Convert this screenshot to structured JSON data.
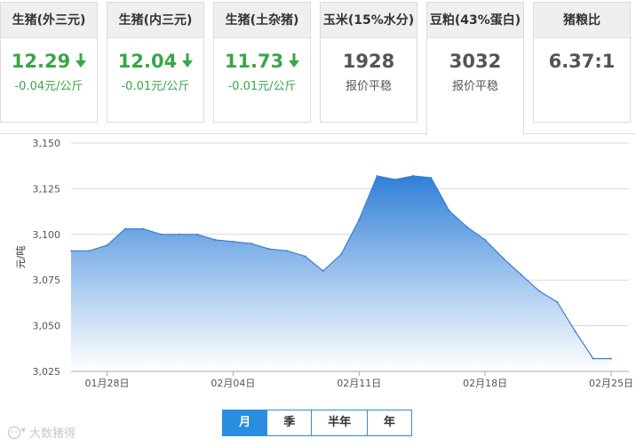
{
  "cards": [
    {
      "title": "生猪(外三元)",
      "value": "12.29",
      "change": "-0.04元/公斤",
      "trend": "down"
    },
    {
      "title": "生猪(内三元)",
      "value": "12.04",
      "change": "-0.01元/公斤",
      "trend": "down"
    },
    {
      "title": "生猪(土杂猪)",
      "value": "11.73",
      "change": "-0.01元/公斤",
      "trend": "down"
    },
    {
      "title": "玉米(15%水分)",
      "value": "1928",
      "change": "报价平稳",
      "trend": "flat"
    },
    {
      "title": "豆粕(43%蛋白)",
      "value": "3032",
      "change": "报价平稳",
      "trend": "flat"
    },
    {
      "title": "猪粮比",
      "value": "6.37:1",
      "change": "",
      "trend": "flat"
    }
  ],
  "colors": {
    "down": "#3aa64a",
    "accent": "#2b8de0",
    "area_top": "#2f7fd8",
    "area_bottom": "#ffffff"
  },
  "chart_data": {
    "type": "area",
    "ylabel": "元/吨",
    "ylim": [
      3025,
      3150
    ],
    "yticks": [
      "3,025",
      "3,050",
      "3,075",
      "3,100",
      "3,125",
      "3,150"
    ],
    "ytick_values": [
      3025,
      3050,
      3075,
      3100,
      3125,
      3150
    ],
    "xtick_labels": [
      "01月28日",
      "02月04日",
      "02月11日",
      "02月18日",
      "02月25日"
    ],
    "xtick_index": [
      2,
      9,
      16,
      23,
      30
    ],
    "grid": true,
    "series": [
      {
        "values": [
          3091,
          3091,
          3094,
          3103,
          3103,
          3100,
          3100,
          3100,
          3097,
          3096,
          3095,
          3092,
          3091,
          3088,
          3080,
          3089,
          3108,
          3132,
          3130,
          3132,
          3131,
          3113,
          3104,
          3097,
          3087,
          3078,
          3069,
          3063,
          3047,
          3032,
          3032
        ]
      }
    ]
  },
  "period_tabs": [
    "月",
    "季",
    "半年",
    "年"
  ],
  "active_tab": "月",
  "watermark": "大数猪得"
}
